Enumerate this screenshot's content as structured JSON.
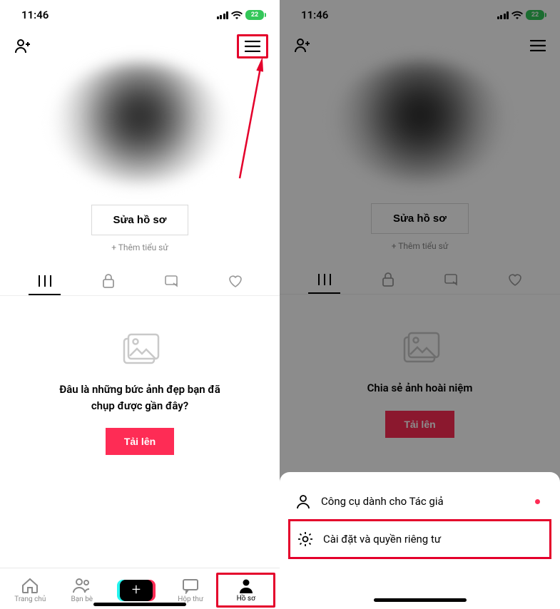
{
  "status": {
    "time": "11:46",
    "battery": "22"
  },
  "profile": {
    "edit_button": "Sửa hồ sơ",
    "add_bio": "+ Thêm tiểu sử"
  },
  "empty_left": {
    "title_line1": "Đâu là những bức ảnh đẹp bạn đã",
    "title_line2": "chụp được gần đây?",
    "upload": "Tải lên"
  },
  "empty_right": {
    "title": "Chia sẻ ảnh hoài niệm",
    "upload": "Tải lên"
  },
  "nav": {
    "home": "Trang chủ",
    "friends": "Bạn bè",
    "inbox": "Hộp thư",
    "profile": "Hồ sơ"
  },
  "sheet": {
    "creator_tools": "Công cụ dành cho Tác giả",
    "settings": "Cài đặt và quyền riêng tư"
  }
}
